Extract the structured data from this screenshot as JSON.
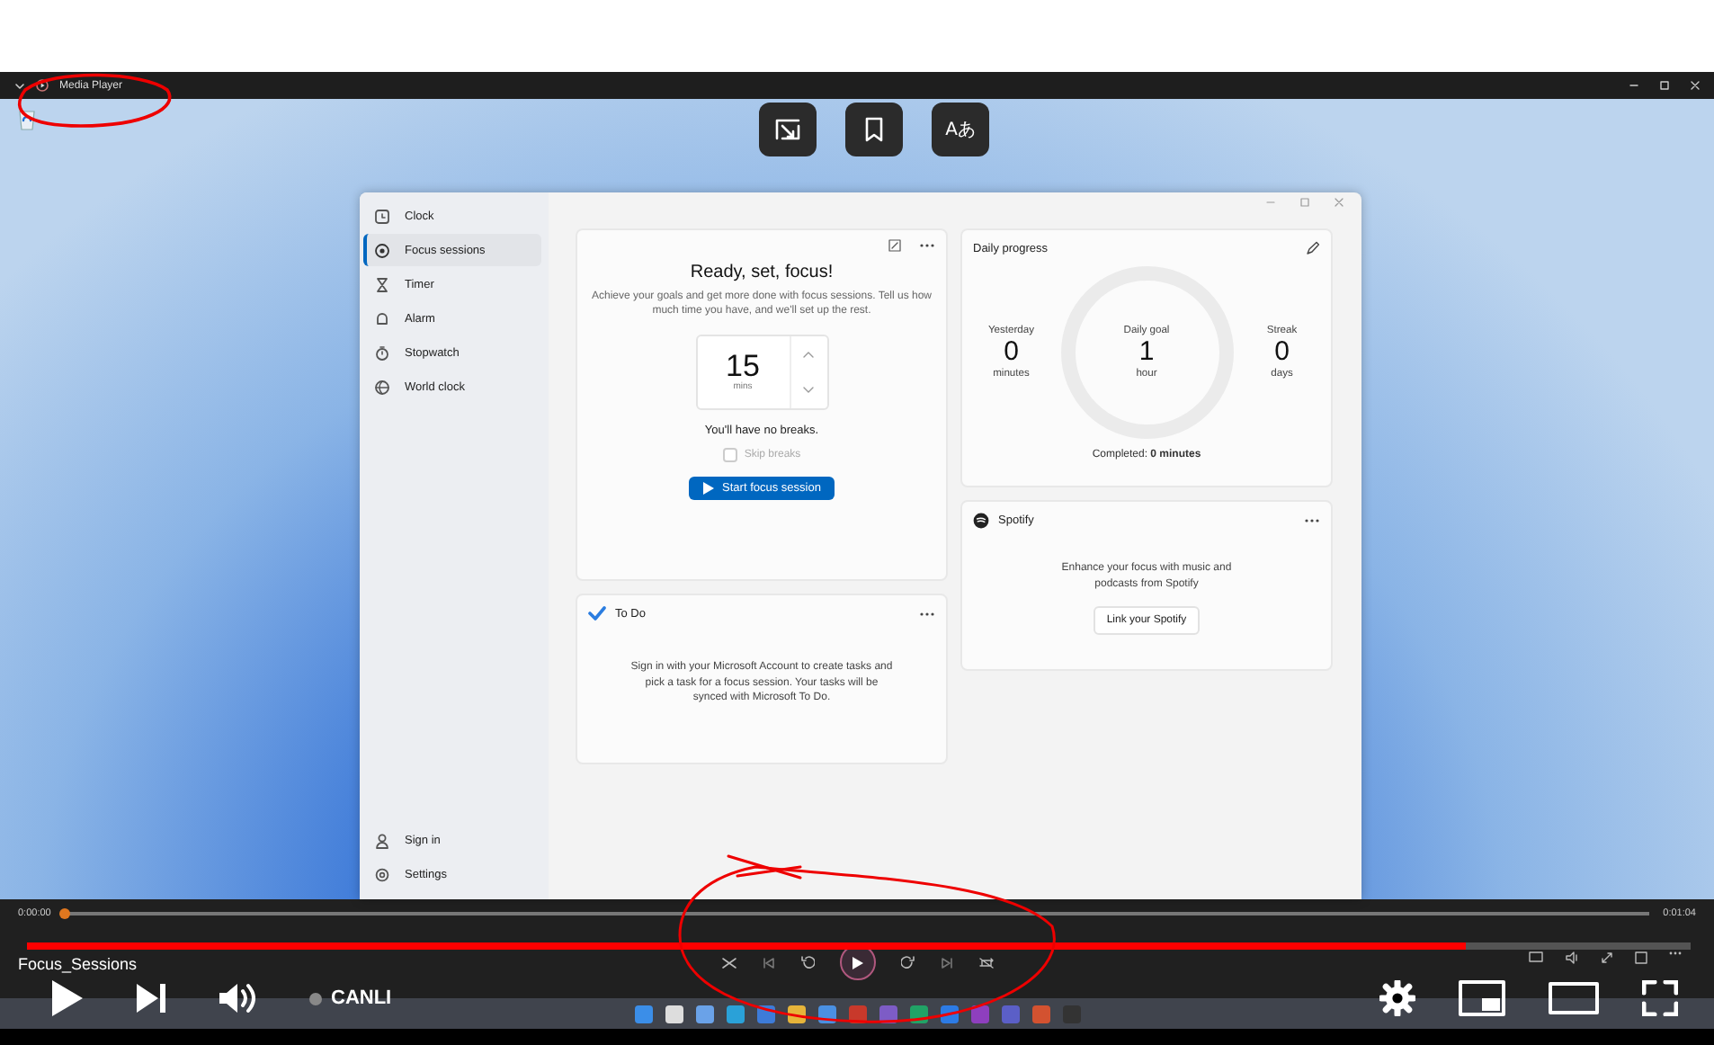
{
  "media_player": {
    "title": "Media Player",
    "time_elapsed": "0:00:00",
    "time_total": "0:01:04",
    "seek": {
      "level": 0.0
    }
  },
  "overlay_actions": {
    "translate_label": "Aあ"
  },
  "clock_app": {
    "nav": [
      {
        "label": "Clock",
        "selected": false
      },
      {
        "label": "Focus sessions",
        "selected": true
      },
      {
        "label": "Timer",
        "selected": false
      },
      {
        "label": "Alarm",
        "selected": false
      },
      {
        "label": "Stopwatch",
        "selected": false
      },
      {
        "label": "World clock",
        "selected": false
      }
    ],
    "bottom_nav": [
      {
        "label": "Sign in"
      },
      {
        "label": "Settings"
      }
    ],
    "focus_card": {
      "title": "Ready, set, focus!",
      "description": "Achieve your goals and get more done with focus sessions. Tell us how much time you have, and we'll set up the rest.",
      "minutes": "15",
      "unit": "mins",
      "breaks_note": "You'll have no breaks.",
      "skip_breaks": {
        "label": "Skip breaks",
        "checked": false,
        "disabled": true
      },
      "start_button": "Start focus session"
    },
    "todo_card": {
      "title": "To Do",
      "message": "Sign in with your Microsoft Account to create tasks and pick a task for a focus session. Your tasks will be synced with Microsoft To Do."
    },
    "daily_progress": {
      "title": "Daily progress",
      "yesterday": {
        "label": "Yesterday",
        "value": "0",
        "unit": "minutes"
      },
      "goal": {
        "label": "Daily goal",
        "value": "1",
        "unit": "hour"
      },
      "streak": {
        "label": "Streak",
        "value": "0",
        "unit": "days"
      },
      "completed": "Completed: **0 minutes**"
    },
    "spotify_card": {
      "title": "Spotify",
      "message": "Enhance your focus with music and podcasts from Spotify",
      "button": "Link your Spotify"
    }
  },
  "youtube": {
    "video_title": "Focus_Sessions",
    "progress": {
      "level": 0.865
    },
    "live_label": "CANLI"
  }
}
